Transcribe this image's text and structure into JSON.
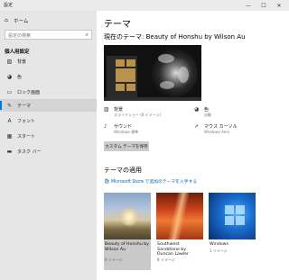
{
  "window": {
    "title": "設定"
  },
  "sidebar": {
    "home_label": "ホーム",
    "search_placeholder": "設定の検索",
    "section_title": "個人用設定",
    "items": [
      {
        "label": "背景",
        "icon": "image-icon"
      },
      {
        "label": "色",
        "icon": "palette-icon"
      },
      {
        "label": "ロック画面",
        "icon": "lock-screen-icon"
      },
      {
        "label": "テーマ",
        "icon": "brush-icon",
        "active": true
      },
      {
        "label": "フォント",
        "icon": "font-icon"
      },
      {
        "label": "スタート",
        "icon": "start-icon"
      },
      {
        "label": "タスク バー",
        "icon": "taskbar-icon"
      }
    ]
  },
  "main": {
    "title": "テーマ",
    "current_theme": "現在のテーマ: Beauty of Honshu by Wilson Au",
    "properties": {
      "background": {
        "name": "背景",
        "value": "スライドショー (8 イメージ)"
      },
      "color": {
        "name": "色",
        "value": "自動"
      },
      "sound": {
        "name": "サウンド",
        "value": "Windows 標準"
      },
      "cursor": {
        "name": "マウス カーソル",
        "value": "Windows Aero"
      }
    },
    "custom_theme_button": "カスタム テーマを保存",
    "apply_heading": "テーマの適用",
    "store_link": "Microsoft Store で追加のテーマを入手する",
    "themes": [
      {
        "name": "Beauty of Honshu by Wilson Au",
        "count": "8 イメージ",
        "selected": true
      },
      {
        "name": "Southwest Sandstone by Duncan Lawler",
        "count": "8 イメージ",
        "selected": false
      },
      {
        "name": "Windows",
        "count": "1 イメージ",
        "selected": false
      }
    ]
  },
  "colors": {
    "accent": "#0078d7",
    "sidebar_bg": "#e6e6e6",
    "link": "#0063b1"
  }
}
